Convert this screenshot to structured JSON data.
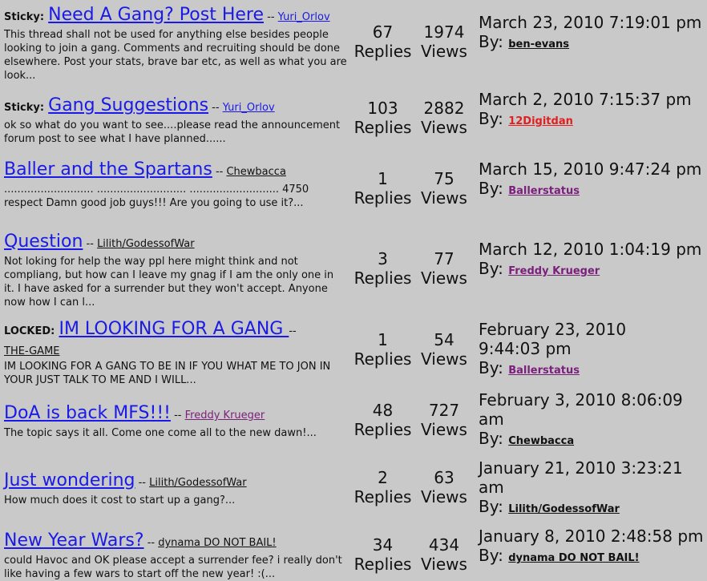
{
  "topics": [
    {
      "prefix": "Sticky:",
      "title": "Need A Gang? Post Here",
      "sep": " -- ",
      "author": "Yuri_Orlov",
      "excerpt": "This thread shall not be used for anything else besides people looking to join a gang. Comments and recruiting should be done elsewhere. Post your stats, brave bar etc, as well as what you are look...",
      "replies": "67",
      "replies_label": "Replies",
      "views": "1974",
      "views_label": "Views",
      "last_date": "March 23, 2010 7:19:01 pm",
      "by_label": "By:",
      "last_user": "ben-evans"
    },
    {
      "prefix": "Sticky:",
      "title": "Gang Suggestions",
      "sep": " -- ",
      "author": "Yuri_Orlov",
      "excerpt": "ok so what do you want to see....please read the announcement forum post to see what I have planned......",
      "replies": "103",
      "replies_label": "Replies",
      "views": "2882",
      "views_label": "Views",
      "last_date": "March 2, 2010 7:15:37 pm",
      "by_label": "By:",
      "last_user": "12Digitdan"
    },
    {
      "prefix": "",
      "title": "Baller and the Spartans",
      "sep": " -- ",
      "author": "Chewbacca",
      "excerpt": "........................... ........................... ........................... 4750 respect Damn good job guys!!! Are you going to use it?...",
      "replies": "1",
      "replies_label": "Replies",
      "views": "75",
      "views_label": "Views",
      "last_date": "March 15, 2010 9:47:24 pm",
      "by_label": "By:",
      "last_user": "Ballerstatus"
    },
    {
      "prefix": "",
      "title": "Question",
      "sep": " -- ",
      "author": "Lilith/GodessofWar",
      "excerpt": "Not loking for help the way ppl here might think and not compliang, but how can I leave my gnag if I am the only one in it. I have asked for a surrender but they won't accept. Anyone now how I can l...",
      "replies": "3",
      "replies_label": "Replies",
      "views": "77",
      "views_label": "Views",
      "last_date": "March 12, 2010 1:04:19 pm",
      "by_label": "By:",
      "last_user": "Freddy Krueger"
    },
    {
      "prefix": "LOCKED:",
      "title": "IM LOOKING FOR A GANG ",
      "sep": " -- ",
      "author": "THE-GAME",
      "excerpt": "IM LOOKING FOR A GANG TO BE IN IF YOU WHAT ME TO JON IN YOUR JUST TALK TO ME AND I WILL...",
      "replies": "1",
      "replies_label": "Replies",
      "views": "54",
      "views_label": "Views",
      "last_date": "February 23, 2010 9:44:03 pm",
      "by_label": "By:",
      "last_user": "Ballerstatus"
    },
    {
      "prefix": "",
      "title": "DoA is back MFS!!!",
      "sep": " -- ",
      "author": "Freddy Krueger",
      "excerpt": "The topic says it all. Come one come all to the new dawn!...",
      "replies": "48",
      "replies_label": "Replies",
      "views": "727",
      "views_label": "Views",
      "last_date": "February 3, 2010 8:06:09 am",
      "by_label": "By:",
      "last_user": "Chewbacca"
    },
    {
      "prefix": "",
      "title": "Just wondering",
      "sep": " -- ",
      "author": "Lilith/GodessofWar",
      "excerpt": "How much does it cost to start up a gang?...",
      "replies": "2",
      "replies_label": "Replies",
      "views": "63",
      "views_label": "Views",
      "last_date": "January 21, 2010 3:23:21 am",
      "by_label": "By:",
      "last_user": "Lilith/GodessofWar"
    },
    {
      "prefix": "",
      "title": "New Year Wars?",
      "sep": " -- ",
      "author": "dynama DO NOT BAIL!",
      "excerpt": "could Havoc and OK please accept a surrender fee? i really don't like having a few wars to start off the new year! :(...",
      "replies": "34",
      "replies_label": "Replies",
      "views": "434",
      "views_label": "Views",
      "last_date": "January 8, 2010 2:48:58 pm",
      "by_label": "By:",
      "last_user": "dynama DO NOT BAIL!"
    }
  ],
  "colors": {
    "background": "#c9c9c9",
    "link_blue": "#1a1ae6",
    "visited_purple": "#7a1f7a",
    "admin_red": "#e02020",
    "text": "#111111"
  }
}
